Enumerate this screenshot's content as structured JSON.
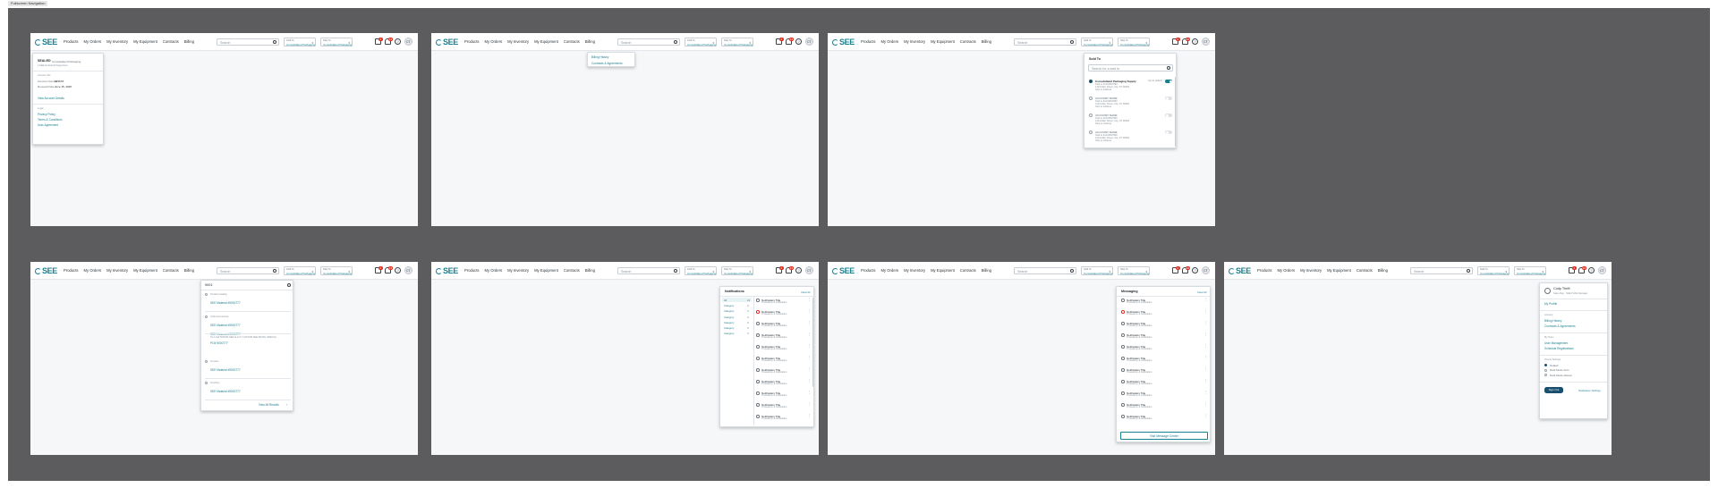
{
  "frame_label": "Fullscreen Navigation",
  "header": {
    "logo_text": "SEE",
    "nav": [
      "Products",
      "My Orders",
      "My Inventory",
      "My Equipment",
      "Contracts",
      "Billing"
    ],
    "search_placeholder": "Search",
    "select_a": {
      "label": "Sold To",
      "value": "Consolidated Packaging"
    },
    "select_b": {
      "label": "Ship To",
      "value": "Consolidated Packaging"
    },
    "cart_count": "4",
    "bell_count": "24",
    "help": "?",
    "avatar": "CT"
  },
  "s1": {
    "title": "SEALED",
    "subtitle": "Consolidated Packaging",
    "line": "2 SEE Authorized Supporters",
    "section": "Account Info",
    "rows": [
      {
        "k": "Account Number",
        "v": "345678"
      },
      {
        "k": "Renewal Date",
        "v": "June 15, 2025"
      }
    ],
    "link1": "View Account Details",
    "section2": "Legal",
    "links": [
      "Privacy Policy",
      "Terms & Conditions",
      "User Agreement"
    ]
  },
  "s2": {
    "items": [
      "Billing History",
      "Contracts & Agreements"
    ]
  },
  "s3": {
    "title": "Sold To",
    "search_placeholder": "Search for a sold to",
    "default_label": "Set as default",
    "accounts": [
      {
        "name": "Consolidated Packaging Supply",
        "l1": "Sold to #1234567890",
        "l2": "1234 Main Street, City, ST 00000",
        "l3": "Ship to Address"
      },
      {
        "name": "ACCOUNT NAME",
        "l1": "Sold to #1234567890",
        "l2": "1234 Main Street, City, ST 00000",
        "l3": "Ship to Address"
      },
      {
        "name": "ACCOUNT NAME",
        "l1": "Sold to #1234567890",
        "l2": "1234 Main Street, City, ST 00000",
        "l3": "Ship to Address"
      },
      {
        "name": "ACCOUNT NAME",
        "l1": "Sold to #1234567890",
        "l2": "1234 Main Street, City, ST 00000",
        "l3": "Ship to Address"
      }
    ]
  },
  "s4": {
    "query": "9001",
    "g1": "Product Catalog",
    "g1_items": [
      "SEE Material #9000777"
    ],
    "g2": "Order Documents",
    "g2_items": [
      "SEE Material #9000777",
      "SEE Material #9000777"
    ],
    "g2_desc": "IN-1 LEFT/FROM SEE ALLOY CUSTOM SEE RETAIL SPECIAL",
    "g2_last": "PO# 9000777",
    "g3": "Invoices",
    "g3_items": [
      "SEE Material #9000777"
    ],
    "g4": "Inventory",
    "g4_items": [
      "SEE Material #9000777"
    ],
    "view_all": "View All Results"
  },
  "s5": {
    "title": "Notifications",
    "action": "Clear All",
    "filters": [
      {
        "label": "All",
        "count": "24"
      },
      {
        "label": "Category",
        "count": "3"
      },
      {
        "label": "Category",
        "count": "3"
      },
      {
        "label": "Category",
        "count": "3"
      },
      {
        "label": "Category",
        "count": "3"
      },
      {
        "label": "Category",
        "count": "3"
      },
      {
        "label": "Category",
        "count": "3"
      }
    ],
    "item_title": "Notification Title",
    "item_sub": "Timestamp & notification",
    "count": 11
  },
  "s6": {
    "title": "Messaging",
    "action": "Clear All",
    "item_title": "Notification Title",
    "item_sub": "Timestamp & notification",
    "count": 11,
    "button": "Visit Message Center"
  },
  "s7": {
    "name": "Cody Thrift",
    "sub": "Sales Rep · SEE Profile Manager",
    "my_profile": "My Profile",
    "sec1": "Account",
    "sec1_links": [
      "Billing History",
      "Contracts & Agreements"
    ],
    "sec2": "My Team",
    "sec2_links": [
      "User Management",
      "Schedule Registrations"
    ],
    "sec3": "Theme Settings",
    "themes": [
      "Default",
      "Dark Mode Auto",
      "Dark Mode Always"
    ],
    "signout": "Sign Out",
    "settings_link": "Notification Settings"
  },
  "colors": {
    "accent": "#1a7f8f",
    "primary": "#1a4f6e",
    "canvas": "#5c5c5e",
    "badge": "#d93025"
  }
}
